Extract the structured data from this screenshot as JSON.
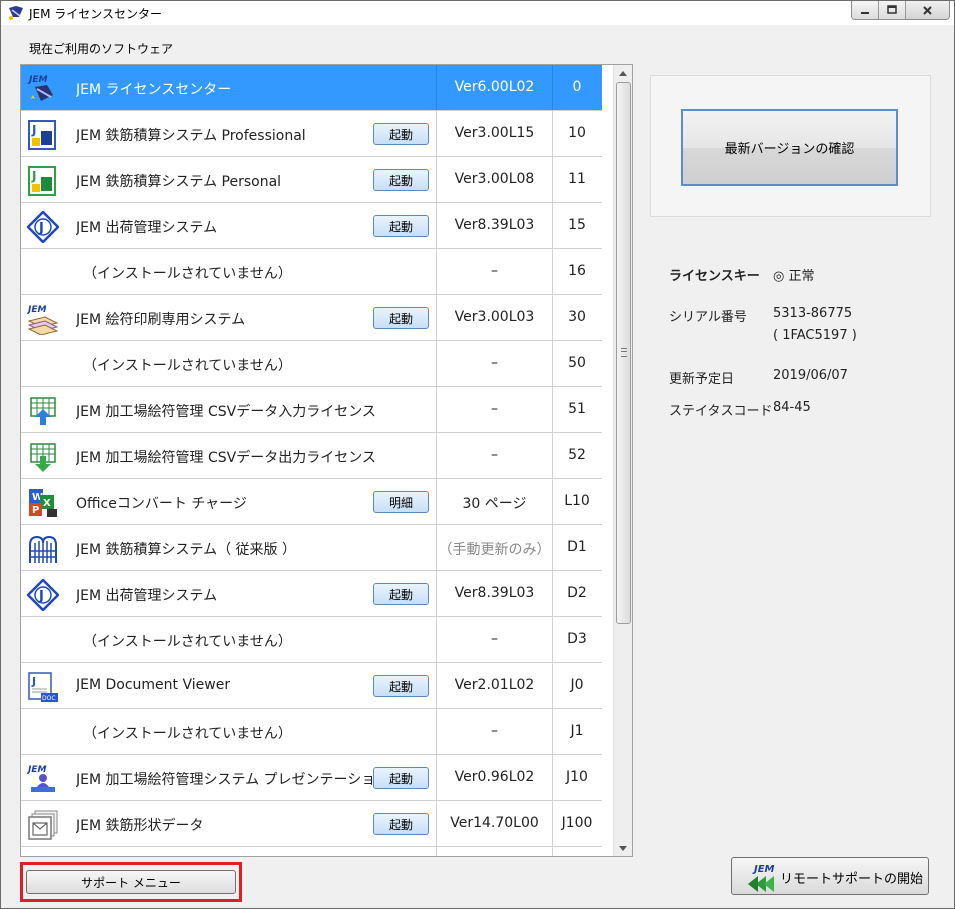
{
  "window": {
    "title": "JEM ライセンスセンター"
  },
  "section_label": "現在ご利用のソフトウェア",
  "rows": [
    {
      "icon": "jem-license-center-icon",
      "name": "JEM ライセンスセンター",
      "button": "",
      "version": "Ver6.00L02",
      "code": "0",
      "selected": true
    },
    {
      "icon": "jem-professional-icon",
      "name": "JEM 鉄筋積算システム Professional",
      "button": "起動",
      "version": "Ver3.00L15",
      "code": "10"
    },
    {
      "icon": "jem-personal-icon",
      "name": "JEM 鉄筋積算システム Personal",
      "button": "起動",
      "version": "Ver3.00L08",
      "code": "11"
    },
    {
      "icon": "jem-shipping-icon",
      "name": "JEM 出荷管理システム",
      "button": "起動",
      "version": "Ver8.39L03",
      "code": "15"
    },
    {
      "icon": "",
      "name": "（インストールされていません）",
      "button": "",
      "version": "–",
      "code": "16",
      "indent": true
    },
    {
      "icon": "jem-tag-print-icon",
      "name": "JEM 絵符印刷専用システム",
      "button": "起動",
      "version": "Ver3.00L03",
      "code": "30"
    },
    {
      "icon": "",
      "name": "（インストールされていません）",
      "button": "",
      "version": "–",
      "code": "50",
      "indent": true
    },
    {
      "icon": "csv-input-icon",
      "name": "JEM 加工場絵符管理 CSVデータ入力ライセンス",
      "button": "",
      "version": "–",
      "code": "51"
    },
    {
      "icon": "csv-output-icon",
      "name": "JEM 加工場絵符管理 CSVデータ出力ライセンス",
      "button": "",
      "version": "–",
      "code": "52"
    },
    {
      "icon": "office-convert-icon",
      "name": "Officeコンバート チャージ",
      "button": "明細",
      "version": "30 ページ",
      "code": "L10"
    },
    {
      "icon": "legacy-rebar-icon",
      "name": "JEM 鉄筋積算システム（ 従来版 ）",
      "button": "",
      "version": "（手動更新のみ）",
      "code": "D1",
      "muted": true
    },
    {
      "icon": "jem-shipping-icon",
      "name": "JEM 出荷管理システム",
      "button": "起動",
      "version": "Ver8.39L03",
      "code": "D2"
    },
    {
      "icon": "",
      "name": "（インストールされていません）",
      "button": "",
      "version": "–",
      "code": "D3",
      "indent": true
    },
    {
      "icon": "document-viewer-icon",
      "name": "JEM Document Viewer",
      "button": "起動",
      "version": "Ver2.01L02",
      "code": "J0"
    },
    {
      "icon": "",
      "name": "（インストールされていません）",
      "button": "",
      "version": "–",
      "code": "J1",
      "indent": true
    },
    {
      "icon": "presentation-icon",
      "name": "JEM 加工場絵符管理システム プレゼンテーション",
      "button": "起動",
      "version": "Ver0.96L02",
      "code": "J10"
    },
    {
      "icon": "rebar-shape-data-icon",
      "name": "JEM 鉄筋形状データ",
      "button": "起動",
      "version": "Ver14.70L00",
      "code": "J100"
    }
  ],
  "right": {
    "check_button": "最新バージョンの確認",
    "license_key_label": "ライセンスキー",
    "license_key_value": "◎ 正常",
    "serial_label": "シリアル番号",
    "serial_value": "5313-86775",
    "serial_sub": "( 1FAC5197 )",
    "renewal_label": "更新予定日",
    "renewal_value": "2019/06/07",
    "status_label": "ステイタスコード",
    "status_value": "84-45"
  },
  "bottom": {
    "support_button": "サポート メニュー",
    "remote_button": "リモートサポートの開始",
    "remote_logo": "JEM"
  },
  "colors": {
    "selection": "#3399ff",
    "highlight_outline": "#e0201f",
    "button_border": "#5a8bbf"
  }
}
